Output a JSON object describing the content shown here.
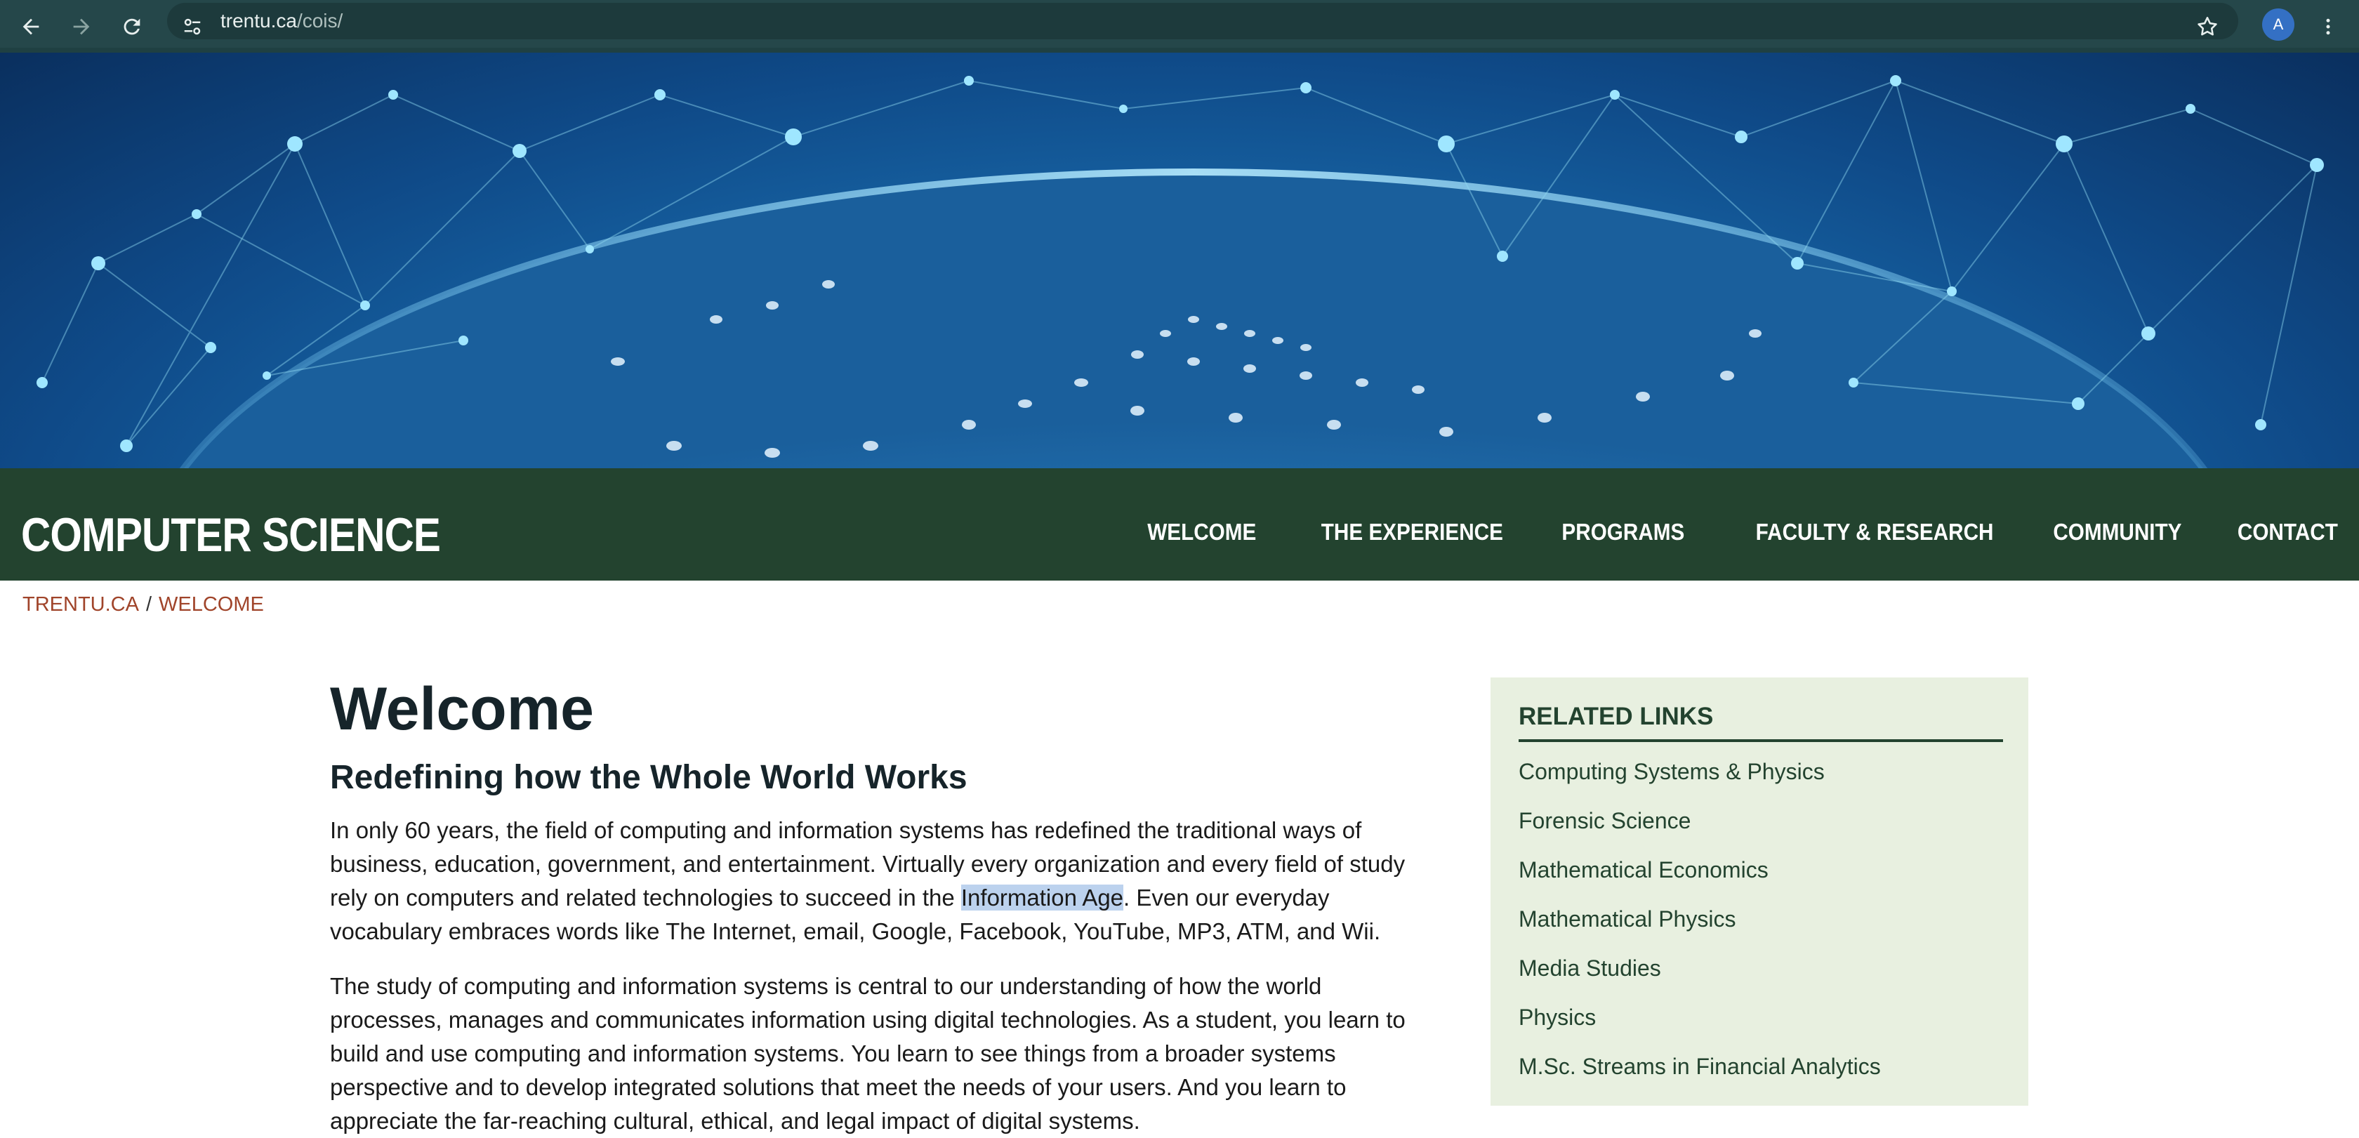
{
  "browser": {
    "url_host": "trentu.ca",
    "url_path": "/cois/",
    "avatar_letter": "A",
    "icons": [
      "back-arrow-icon",
      "forward-arrow-icon",
      "reload-icon",
      "site-settings-icon",
      "star-icon",
      "kebab-menu-icon"
    ]
  },
  "site": {
    "title": "COMPUTER SCIENCE"
  },
  "nav": {
    "items": [
      {
        "label": "WELCOME"
      },
      {
        "label": "THE EXPERIENCE"
      },
      {
        "label": "PROGRAMS"
      },
      {
        "label": "FACULTY & RESEARCH"
      },
      {
        "label": "COMMUNITY"
      },
      {
        "label": "CONTACT"
      }
    ]
  },
  "breadcrumb": {
    "home": "TRENTU.CA",
    "separator": "/",
    "current": "WELCOME"
  },
  "main": {
    "title": "Welcome",
    "subtitle": "Redefining how the Whole World Works",
    "para1_before": "In only 60 years, the field of computing and information systems has redefined the traditional ways of business, education, government, and entertainment.  Virtually every organization and every field of study rely on computers and related technologies to succeed in the ",
    "para1_highlight": "Information Age",
    "para1_after": ".  Even our everyday vocabulary embraces words like The Internet, email, Google, Facebook, YouTube, MP3, ATM, and Wii.",
    "para2": "The study of computing and information systems is central to our understanding of how the world processes, manages and communicates information using digital technologies.  As a student, you learn to build and use computing and information systems.  You learn to see things from a broader systems perspective and to develop integrated solutions that meet the needs of your users.  And you learn to appreciate the far-reaching cultural, ethical, and legal impact of digital systems."
  },
  "related": {
    "title": "RELATED LINKS",
    "links": [
      {
        "label": "Computing Systems & Physics"
      },
      {
        "label": "Forensic Science"
      },
      {
        "label": "Mathematical Economics"
      },
      {
        "label": "Mathematical Physics"
      },
      {
        "label": "Media Studies"
      },
      {
        "label": "Physics"
      },
      {
        "label": "M.Sc. Streams in Financial Analytics"
      }
    ]
  },
  "colors": {
    "chrome_bg": "#25474a",
    "band_bg": "#23432f",
    "breadcrumb": "#a0442a",
    "related_bg": "#e8f0e0",
    "highlight": "#bcd2ee"
  }
}
